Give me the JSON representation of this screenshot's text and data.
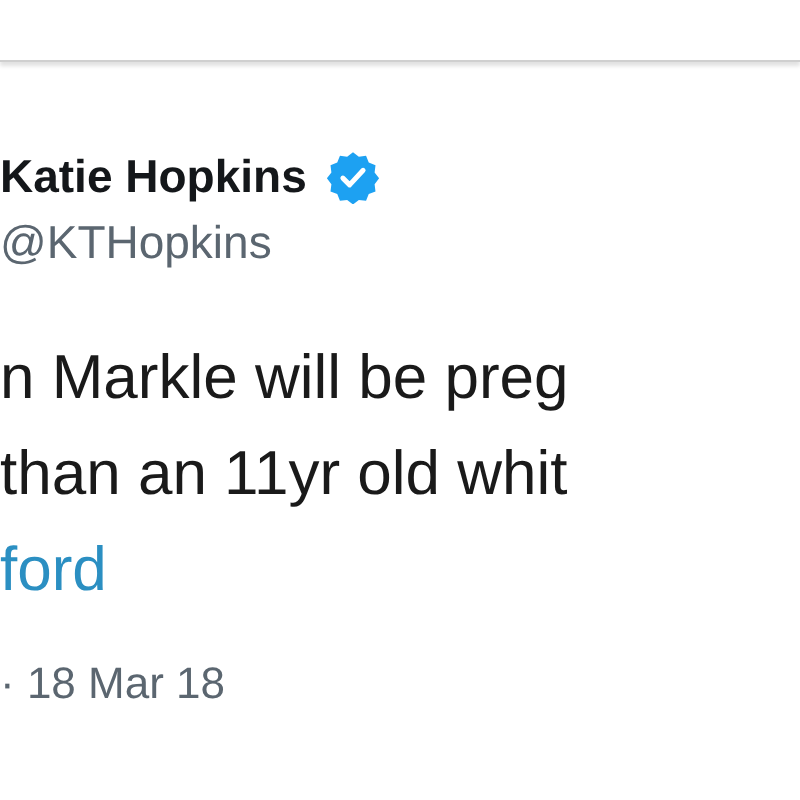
{
  "author": {
    "name": "Katie Hopkins",
    "verified": true,
    "handle": "@KTHopkins"
  },
  "tweet": {
    "lines": [
      {
        "text": "n Markle will be preg",
        "kind": "plain"
      },
      {
        "text": "than an 11yr old whit",
        "kind": "plain"
      },
      {
        "text": "ford",
        "kind": "link"
      }
    ],
    "date": "· 18 Mar 18"
  }
}
